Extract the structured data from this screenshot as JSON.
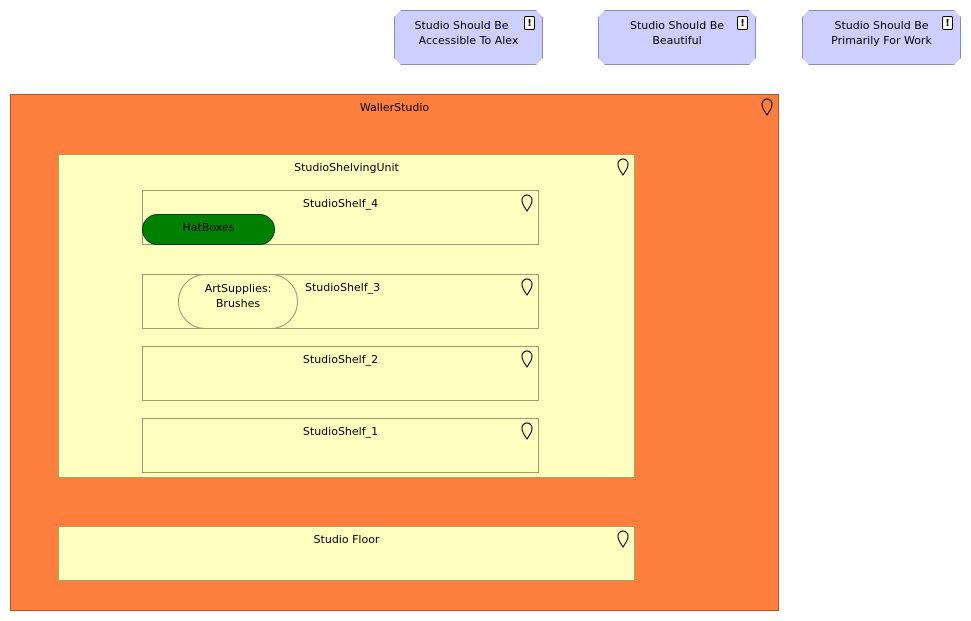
{
  "requirements": [
    {
      "text_line1": "Studio Should Be",
      "text_line2": "Accessible To Alex",
      "icon": "exclamation-icon"
    },
    {
      "text_line1": "Studio Should Be",
      "text_line2": "Beautiful",
      "icon": "exclamation-icon"
    },
    {
      "text_line1": "Studio Should Be",
      "text_line2": "Primarily For Work",
      "icon": "exclamation-icon"
    }
  ],
  "location": {
    "label": "WallerStudio",
    "icon": "location-pin-icon"
  },
  "shelving_unit": {
    "label": "StudioShelvingUnit",
    "icon": "location-pin-icon"
  },
  "shelves": [
    {
      "label": "StudioShelf_4"
    },
    {
      "label": "StudioShelf_3"
    },
    {
      "label": "StudioShelf_2"
    },
    {
      "label": "StudioShelf_1"
    }
  ],
  "items": {
    "hatboxes": {
      "label": "HatBoxes",
      "color": "#008000"
    },
    "artsupplies": {
      "label_line1": "ArtSupplies:",
      "label_line2": "Brushes"
    }
  },
  "floor": {
    "label": "Studio Floor"
  },
  "colors": {
    "requirement_fill": "#cccfff",
    "studio_fill": "#ff7f3f",
    "container_fill": "#ffffc0",
    "item_green": "#008000"
  }
}
